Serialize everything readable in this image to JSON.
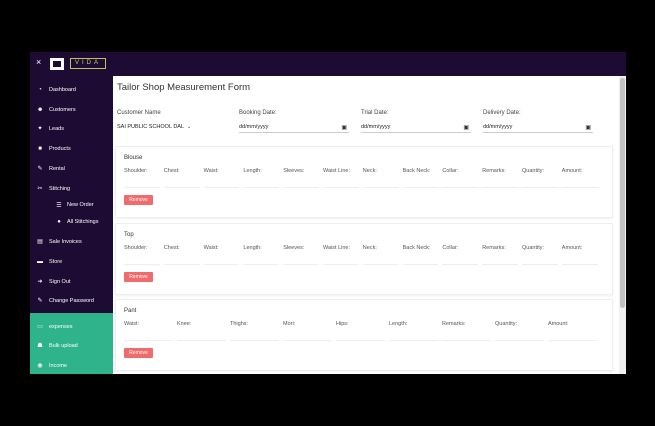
{
  "topbar": {
    "close": "×",
    "brand": "VIDA"
  },
  "sidebar": {
    "items": [
      {
        "label": "Dashboard",
        "icon": "dashboard-icon",
        "glyph": "◔"
      },
      {
        "label": "Customers",
        "icon": "users-icon",
        "glyph": "☻"
      },
      {
        "label": "Leads",
        "icon": "leads-icon",
        "glyph": "✦"
      },
      {
        "label": "Products",
        "icon": "box-icon",
        "glyph": "■"
      },
      {
        "label": "Rental",
        "icon": "key-icon",
        "glyph": "✎"
      },
      {
        "label": "Stitching",
        "icon": "scissors-icon",
        "glyph": "✂"
      }
    ],
    "sub_items": [
      {
        "label": "New Order",
        "glyph": "☰"
      },
      {
        "label": "All Stitchings",
        "glyph": "●"
      }
    ],
    "items2": [
      {
        "label": "Sale Invoices",
        "icon": "invoice-icon",
        "glyph": "▤"
      },
      {
        "label": "Store",
        "icon": "store-icon",
        "glyph": "▬"
      },
      {
        "label": "Sign Out",
        "icon": "signout-icon",
        "glyph": "➜"
      },
      {
        "label": "Change Password",
        "icon": "key-icon",
        "glyph": "✎"
      }
    ],
    "green_items": [
      {
        "label": "expenses",
        "icon": "card-icon",
        "glyph": "▭"
      },
      {
        "label": "Bulk upload",
        "icon": "upload-icon",
        "glyph": "☗"
      },
      {
        "label": "Income",
        "icon": "income-icon",
        "glyph": "◉"
      }
    ]
  },
  "main": {
    "title": "Tailor Shop Measurement Form",
    "customer_label": "Customer Name",
    "customer_value": "SAI PUBLIC SCHOOL DAL",
    "booking_label": "Booking Date:",
    "trial_label": "Trial Date:",
    "delivery_label": "Delivery Date:",
    "date_placeholder": "dd/mm/yyyy",
    "remove_label": "Remove",
    "sections": [
      {
        "title": "Blouse",
        "fields": [
          "Shoulder:",
          "Chest:",
          "Waist:",
          "Length:",
          "Sleeves:",
          "Waist Line:",
          "Neck:",
          "Back Neck:",
          "Collar:",
          "Remarks:",
          "Quantity:",
          "Amount:"
        ]
      },
      {
        "title": "Top",
        "fields": [
          "Shoulder:",
          "Chest:",
          "Waist:",
          "Length:",
          "Sleeves:",
          "Waist Line:",
          "Neck:",
          "Back Neck:",
          "Collar:",
          "Remarks:",
          "Quantity:",
          "Amount:"
        ]
      },
      {
        "title": "Pant",
        "fields": [
          "Waist:",
          "Knee:",
          "Thighs:",
          "Mori:",
          "Hips:",
          "Length:",
          "Remarks:",
          "Quantity:",
          "Amount:"
        ]
      }
    ]
  },
  "colors": {
    "sidebar": "#1d0b33",
    "green": "#2eb38a",
    "remove": "#f06b6b"
  }
}
